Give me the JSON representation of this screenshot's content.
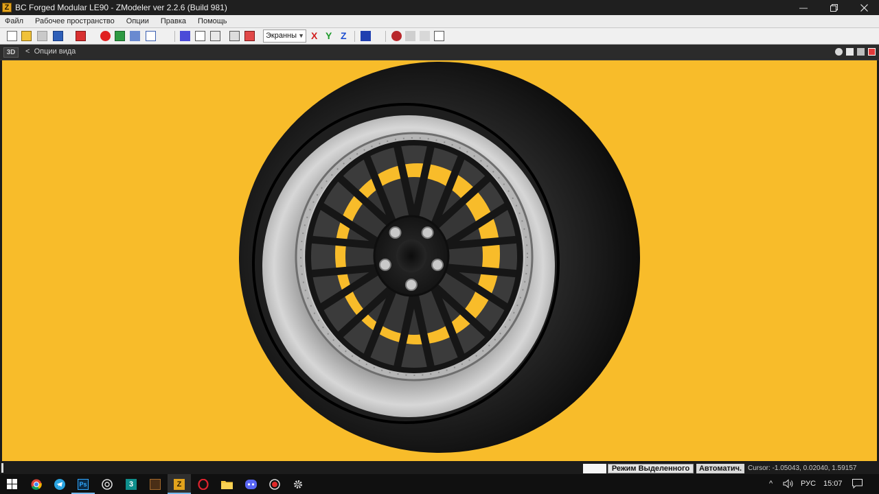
{
  "window": {
    "title": "BC Forged Modular LE90 - ZModeler ver 2.2.6 (Build 981)",
    "app_icon_letter": "Z",
    "controls": [
      "minimize-icon",
      "restore-icon",
      "close-icon"
    ]
  },
  "menubar": {
    "items": [
      "Файл",
      "Рабочее пространство",
      "Опции",
      "Правка",
      "Помощь"
    ]
  },
  "toolbar": {
    "render_mode": "Экранны",
    "axes": [
      "X",
      "Y",
      "Z"
    ],
    "axis_colors": {
      "X": "#d11f1f",
      "Y": "#1d9a2b",
      "Z": "#1f4fd1"
    }
  },
  "viewport": {
    "badge": "3D",
    "options_label": "Опции вида",
    "background": "#f8bc2a"
  },
  "statusbar": {
    "mode": "Режим Выделенного",
    "auto": "Автоматич.",
    "cursor": "Cursor: -1.05043, 0.02040, 1.59157"
  },
  "taskbar": {
    "apps": [
      "start-icon",
      "chrome-icon",
      "telegram-icon",
      "photoshop-icon",
      "obs-icon",
      "3dsmax-icon",
      "app-icon",
      "zmodeler-icon",
      "opera-icon",
      "explorer-icon",
      "discord-icon",
      "record-icon",
      "settings-icon"
    ],
    "photoshop_label": "Ps",
    "max_label": "3",
    "zmodeler_label": "Z",
    "tray_chevron": "^",
    "language": "РУС",
    "time": "15:07"
  }
}
